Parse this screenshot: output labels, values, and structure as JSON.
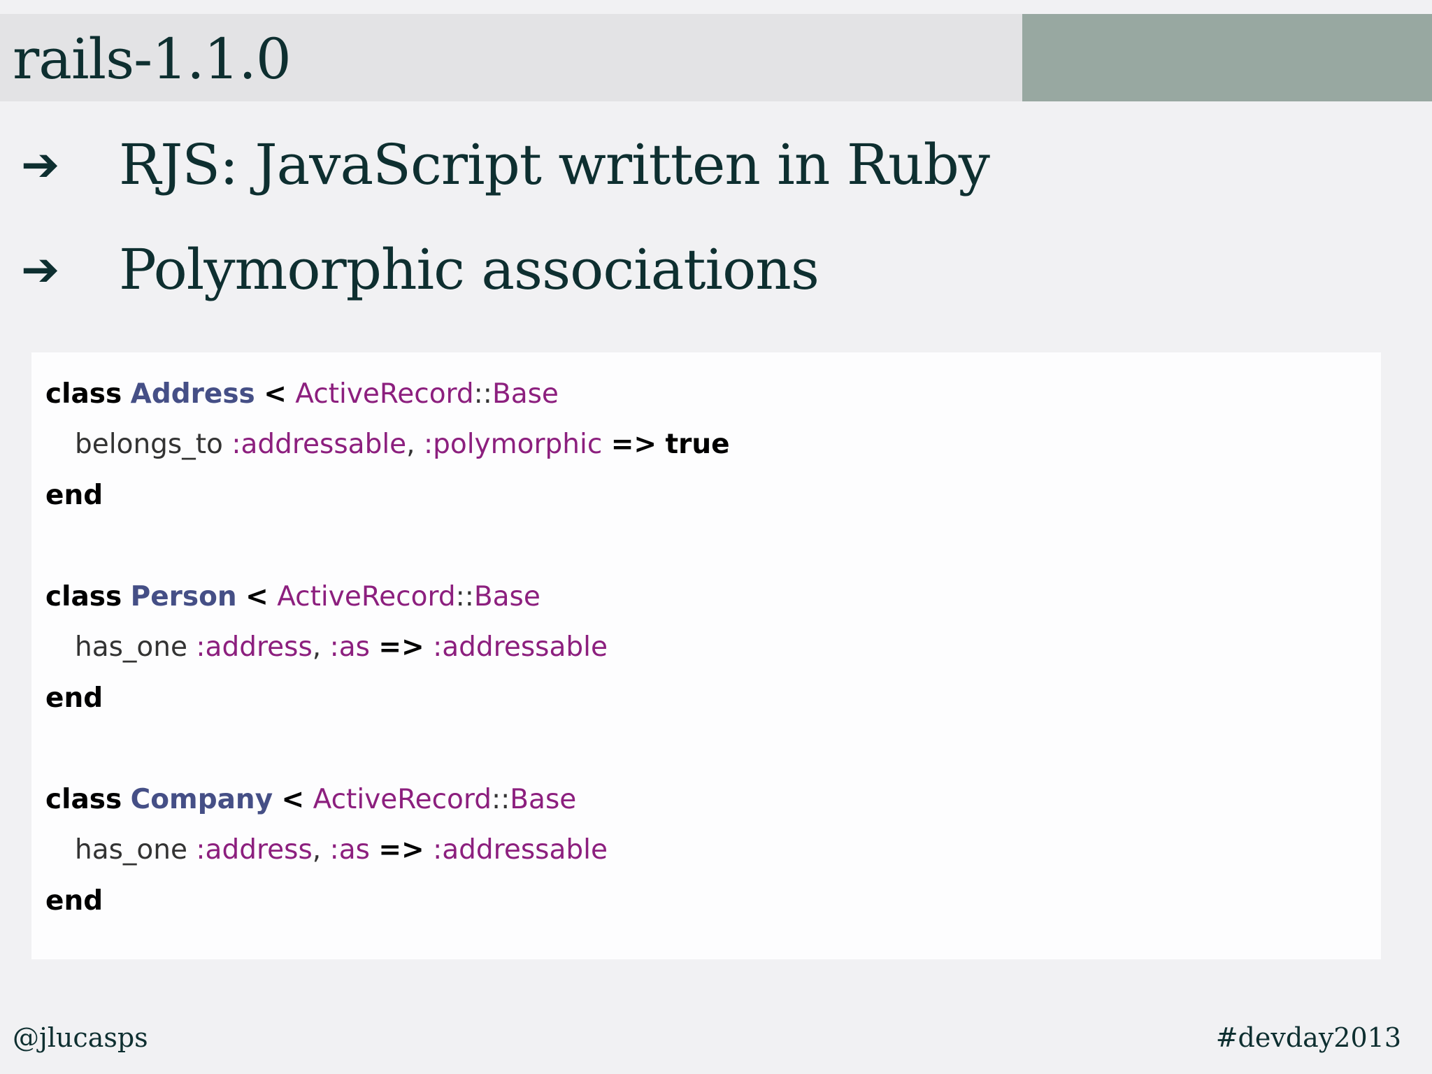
{
  "slide": {
    "title": "rails-1.1.0",
    "bullets": [
      {
        "arrow": "➔",
        "text": "RJS: JavaScript written in Ruby"
      },
      {
        "arrow": "➔",
        "text": "Polymorphic associations"
      }
    ]
  },
  "code": {
    "blocks": [
      {
        "kw_class": "class",
        "name": "Address",
        "lt": "<",
        "parent_a": "ActiveRecord",
        "sep": "::",
        "parent_b": "Base",
        "body": {
          "method": "belongs_to",
          "arg1": ":addressable",
          "comma": ",",
          "arg2": ":polymorphic",
          "arrow": "=>",
          "value": "true"
        },
        "kw_end": "end"
      },
      {
        "kw_class": "class",
        "name": "Person",
        "lt": "<",
        "parent_a": "ActiveRecord",
        "sep": "::",
        "parent_b": "Base",
        "body": {
          "method": "has_one",
          "arg1": ":address",
          "comma": ",",
          "arg2": ":as",
          "arrow": "=>",
          "value": ":addressable"
        },
        "kw_end": "end"
      },
      {
        "kw_class": "class",
        "name": "Company",
        "lt": "<",
        "parent_a": "ActiveRecord",
        "sep": "::",
        "parent_b": "Base",
        "body": {
          "method": "has_one",
          "arg1": ":address",
          "comma": ",",
          "arg2": ":as",
          "arrow": "=>",
          "value": ":addressable"
        },
        "kw_end": "end"
      }
    ]
  },
  "footer": {
    "handle": "@jlucasps",
    "hashtag": "#devday2013"
  },
  "colors": {
    "title_bar": "#e3e3e5",
    "title_accent": "#98a8a1",
    "text_dark": "#0e2f30",
    "class_name": "#454f86",
    "constant": "#8c1f7e"
  }
}
